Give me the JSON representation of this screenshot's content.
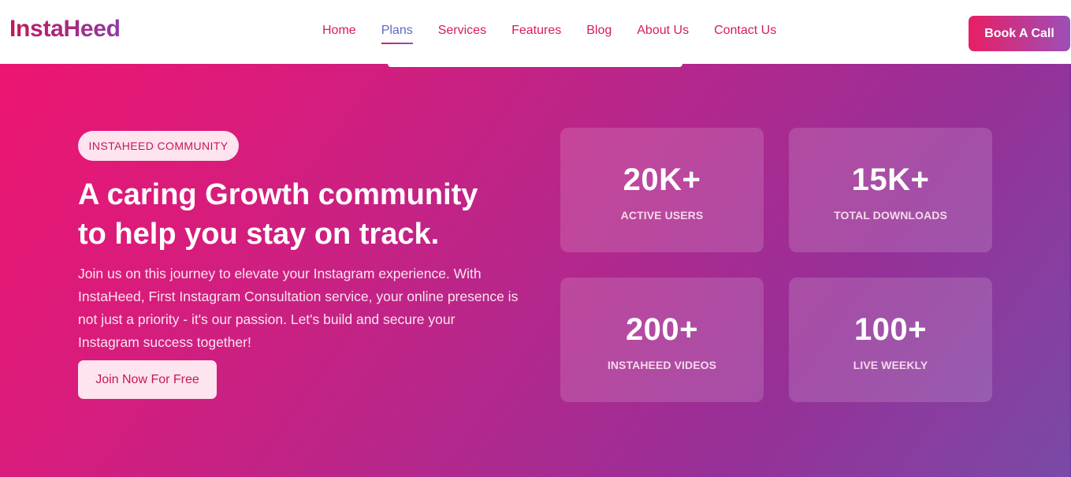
{
  "header": {
    "logo": "InstaHeed",
    "nav": [
      {
        "label": "Home",
        "active": false
      },
      {
        "label": "Plans",
        "active": true
      },
      {
        "label": "Services",
        "active": false
      },
      {
        "label": "Features",
        "active": false
      },
      {
        "label": "Blog",
        "active": false
      },
      {
        "label": "About Us",
        "active": false
      },
      {
        "label": "Contact Us",
        "active": false
      }
    ],
    "cta_label": "Book A Call"
  },
  "hero": {
    "badge": "INSTAHEED COMMUNITY",
    "title_line1": "A caring Growth community",
    "title_line2": "to help you stay on track.",
    "description": "Join us on this journey to elevate your Instagram experience. With InstaHeed, First Instagram Consultation service, your online presence is not just a priority - it's our passion. Let's build and secure your Instagram success together!",
    "join_label": "Join Now For Free"
  },
  "stats": [
    {
      "value": "20K+",
      "label": "ACTIVE USERS"
    },
    {
      "value": "15K+",
      "label": "TOTAL DOWNLOADS"
    },
    {
      "value": "200+",
      "label": "INSTAHEED VIDEOS"
    },
    {
      "value": "100+",
      "label": "LIVE WEEKLY"
    }
  ],
  "colors": {
    "brand_pink": "#e91e63",
    "brand_purple": "#8e3aa5",
    "active_nav": "#5c6bc0"
  }
}
